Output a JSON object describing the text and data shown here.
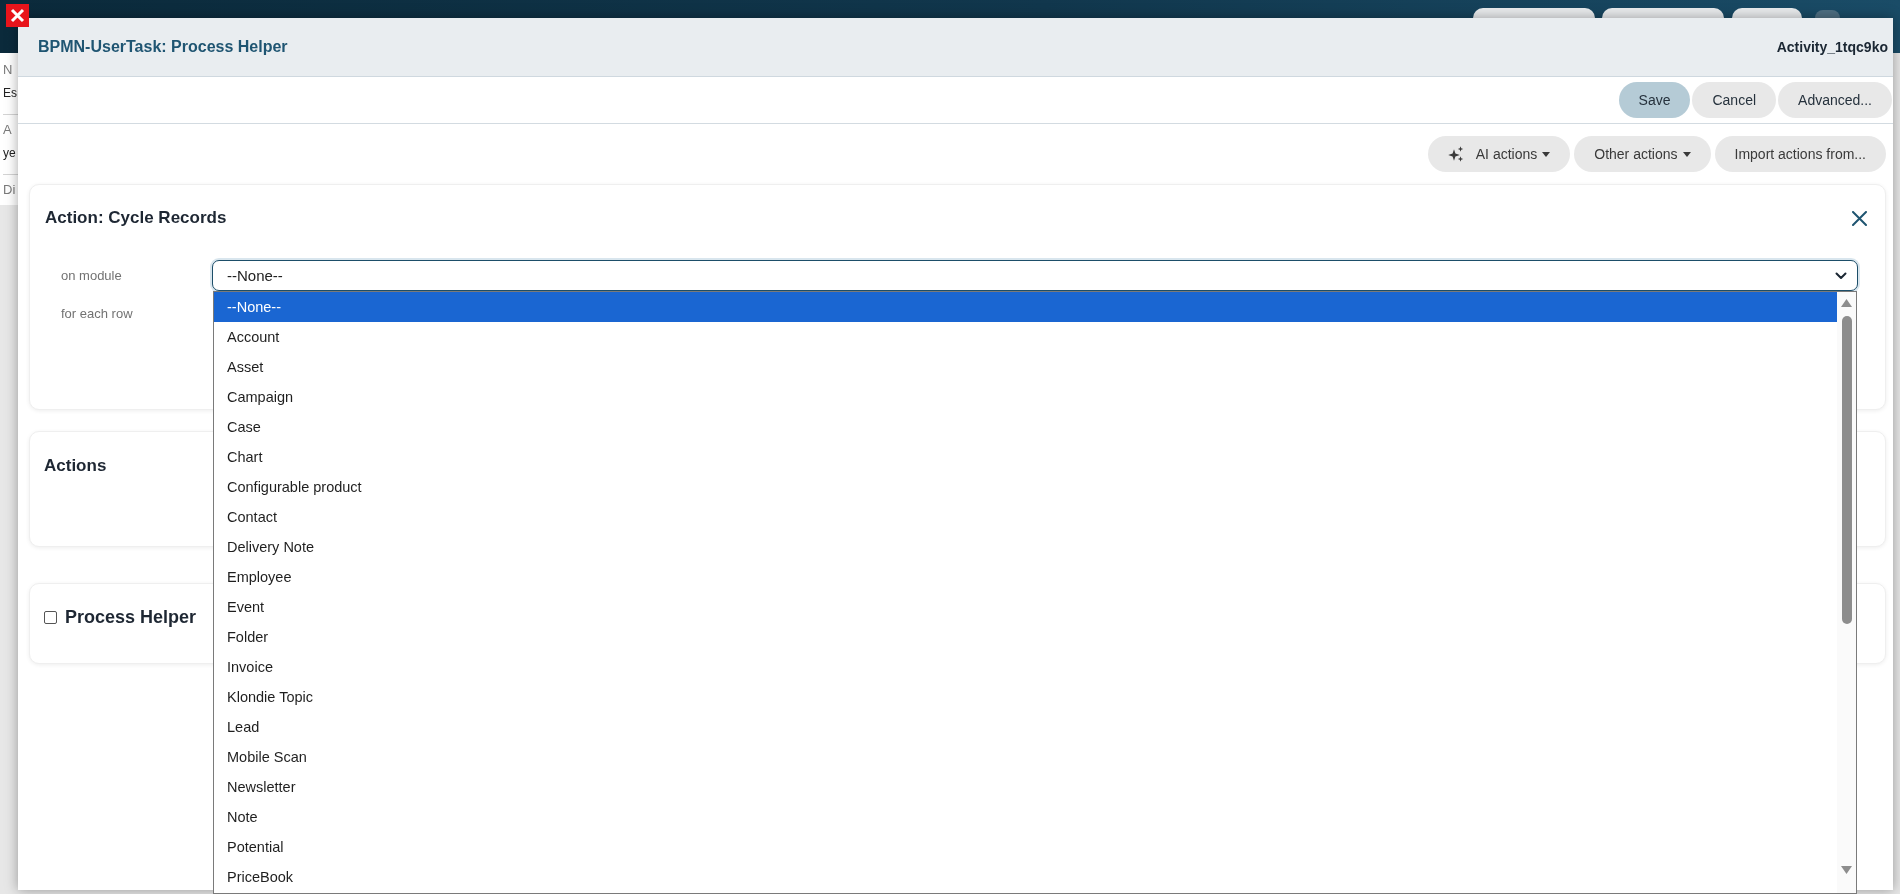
{
  "background_page": {
    "fields": [
      {
        "label": "N",
        "value": "Es"
      },
      {
        "label": "A",
        "value": "ye"
      },
      {
        "label": "Di"
      }
    ]
  },
  "dialog": {
    "title": "BPMN-UserTask: Process Helper",
    "element_id": "Activity_1tqc9ko",
    "toolbar": [
      {
        "label": "Save",
        "kind": "primary"
      },
      {
        "label": "Cancel",
        "kind": "default"
      },
      {
        "label": "Advanced...",
        "kind": "default"
      }
    ],
    "action_buttons": [
      {
        "label": "AI actions",
        "kind": "ai_menu"
      },
      {
        "label": "Other actions",
        "kind": "menu"
      },
      {
        "label": "Import actions from...",
        "kind": "plain"
      }
    ],
    "action_card": {
      "title": "Action: Cycle Records",
      "fields": [
        {
          "label": "on module",
          "kind": "select",
          "value": "--None--",
          "expanded": true,
          "options": [
            {
              "label": "--None--",
              "selected": true
            },
            {
              "label": "Account",
              "selected": false
            },
            {
              "label": "Asset",
              "selected": false
            },
            {
              "label": "Campaign",
              "selected": false
            },
            {
              "label": "Case",
              "selected": false
            },
            {
              "label": "Chart",
              "selected": false
            },
            {
              "label": "Configurable product",
              "selected": false
            },
            {
              "label": "Contact",
              "selected": false
            },
            {
              "label": "Delivery Note",
              "selected": false
            },
            {
              "label": "Employee",
              "selected": false
            },
            {
              "label": "Event",
              "selected": false
            },
            {
              "label": "Folder",
              "selected": false
            },
            {
              "label": "Invoice",
              "selected": false
            },
            {
              "label": "Klondie Topic",
              "selected": false
            },
            {
              "label": "Lead",
              "selected": false
            },
            {
              "label": "Mobile Scan",
              "selected": false
            },
            {
              "label": "Newsletter",
              "selected": false
            },
            {
              "label": "Note",
              "selected": false
            },
            {
              "label": "Potential",
              "selected": false
            },
            {
              "label": "PriceBook",
              "selected": false
            }
          ]
        },
        {
          "label": "for each row",
          "kind": "label_only"
        }
      ]
    },
    "actions_card": {
      "title": "Actions"
    },
    "process_helper_card": {
      "title": "Process Helper",
      "checked": false
    }
  }
}
